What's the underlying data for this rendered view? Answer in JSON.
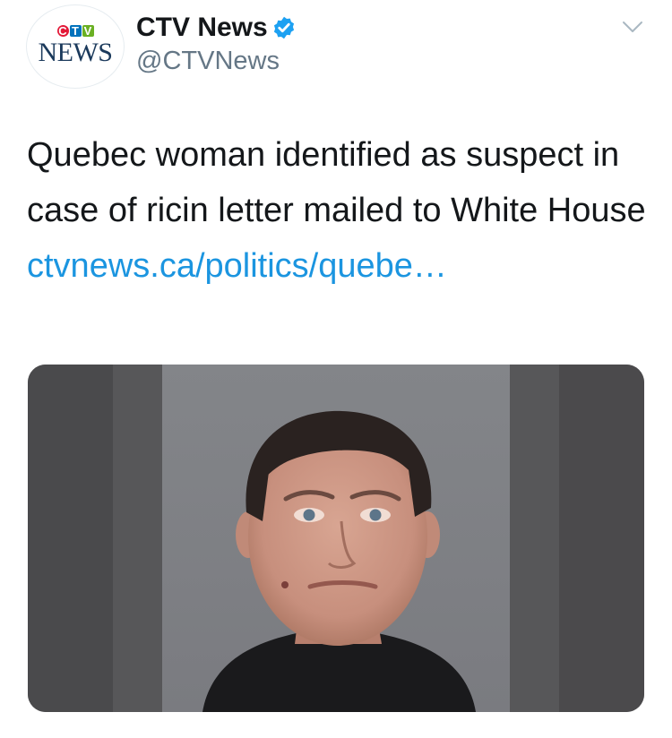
{
  "account": {
    "display_name": "CTV News",
    "handle": "@CTVNews",
    "verified": true,
    "avatar_logo_top": [
      "C",
      "T",
      "V"
    ],
    "avatar_logo_bottom": "NEWS"
  },
  "tweet": {
    "text": "Quebec woman identified as suspect in case of ricin letter mailed to White House ",
    "link_text": "ctvnews.ca/politics/quebe…"
  },
  "icons": {
    "verified": "verified-badge-icon",
    "menu": "chevron-down-icon"
  },
  "colors": {
    "link": "#1b95e0",
    "verified": "#1da1f2",
    "handle": "#657786"
  }
}
